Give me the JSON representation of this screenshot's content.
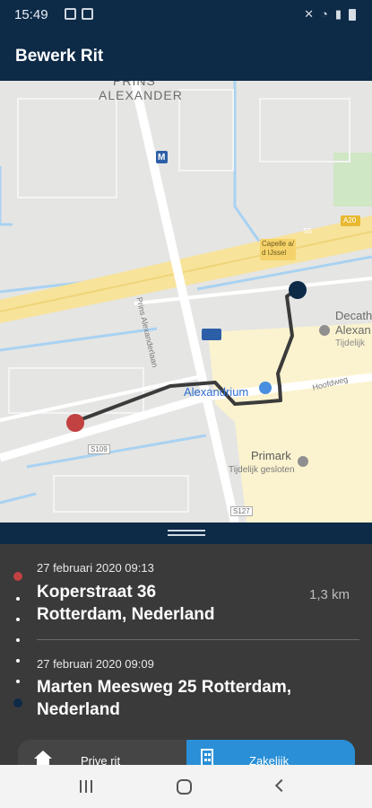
{
  "status_bar": {
    "time": "15:49"
  },
  "app_bar": {
    "title": "Bewerk Rit"
  },
  "map": {
    "labels": {
      "district_1": "PRINS",
      "district_2": "ALEXANDER",
      "street": "Prins Alexanderlaan",
      "highway_shield": "A20",
      "highway_code": "S5",
      "station_1": "Capelle a/",
      "station_2": "d IJssel",
      "poi_mall": "Alexandrium",
      "poi_primark": "Primark",
      "poi_primark_status": "Tijdelijk gesloten",
      "poi_decathlon_1": "Decath",
      "poi_decathlon_2": "Alexan",
      "poi_decathlon_status": "Tijdelijk",
      "road_hoofdweg": "Hoofdweg",
      "road_s109": "S109",
      "road_s127": "S127",
      "metro_sign": "M"
    },
    "colors": {
      "start_marker": "#c24141",
      "end_marker": "#0d2a47",
      "route": "#3b3b3b"
    }
  },
  "trip": {
    "start": {
      "datetime": "27 februari 2020 09:13",
      "address_line1": "Koperstraat 36",
      "address_line2": "Rotterdam, Nederland"
    },
    "distance": "1,3 km",
    "end": {
      "datetime": "27 februari 2020 09:09",
      "address_line1": "Marten Meesweg 25 Rotterdam,",
      "address_line2": "Nederland"
    }
  },
  "trip_type": {
    "private_label": "Prive rit",
    "business_label": "Zakelijk",
    "selected": "Zakelijk",
    "accent": "#2a8fd6"
  }
}
